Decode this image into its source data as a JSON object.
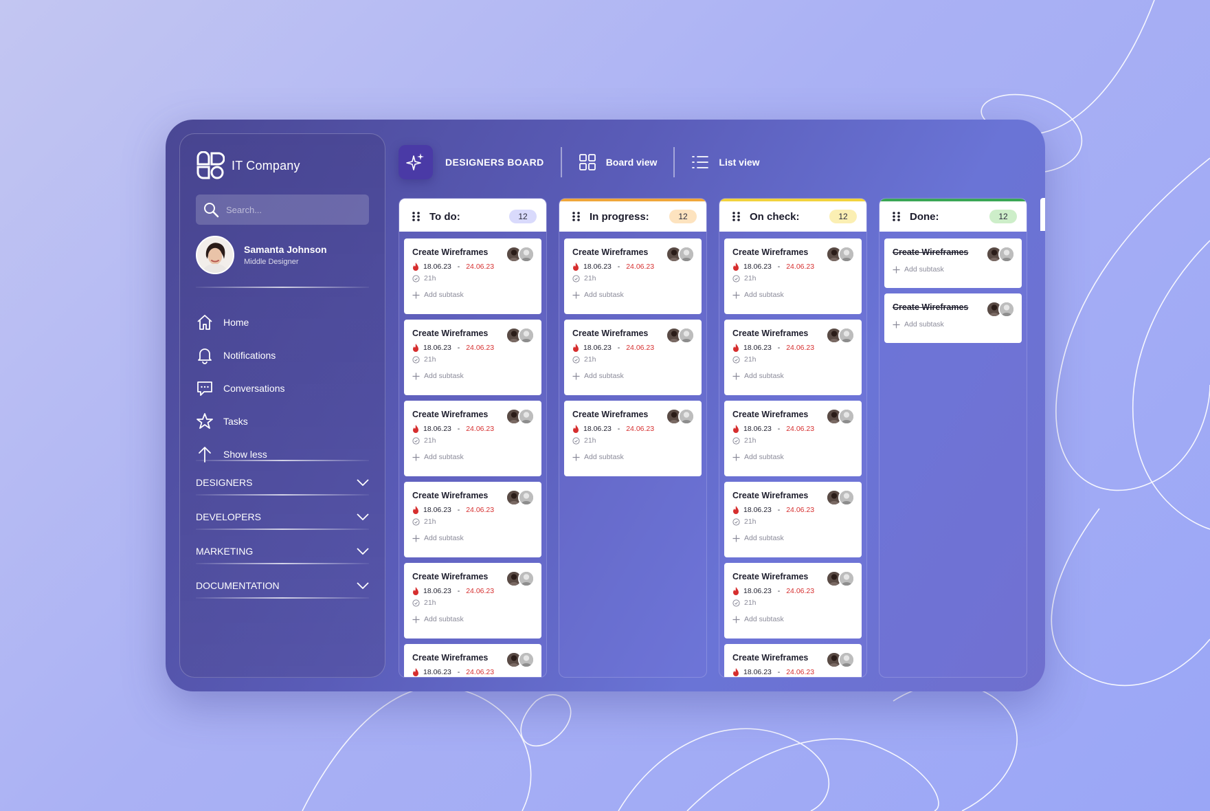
{
  "app": {
    "brand_name": "IT Company",
    "search_placeholder": "Search...",
    "user": {
      "name": "Samanta Johnson",
      "role": "Middle Designer"
    },
    "nav": [
      {
        "label": "Home",
        "icon": "home-icon"
      },
      {
        "label": "Notifications",
        "icon": "bell-icon"
      },
      {
        "label": "Conversations",
        "icon": "chat-icon"
      },
      {
        "label": "Tasks",
        "icon": "star-icon"
      },
      {
        "label": "Show less",
        "icon": "arrow-up-icon"
      }
    ],
    "groups": [
      "DESIGNERS",
      "DEVELOPERS",
      "MARKETING",
      "DOCUMENTATION"
    ]
  },
  "header": {
    "board_title": "DESIGNERS BOARD",
    "board_view_label": "Board view",
    "list_view_label": "List view"
  },
  "card_text": {
    "title": "Create Wireframes",
    "start": "18.06.23",
    "separator": " - ",
    "due": "24.06.23",
    "time": "21h",
    "add_subtask": "Add subtask"
  },
  "columns": [
    {
      "title": "To do:",
      "count": "12",
      "accent": "#ffffff",
      "badge_color": "#d9dafc",
      "cards": 6,
      "style": "full"
    },
    {
      "title": "In progress:",
      "count": "12",
      "accent": "#f0a63a",
      "badge_color": "#fde3bf",
      "cards": 3,
      "style": "full"
    },
    {
      "title": "On check:",
      "count": "12",
      "accent": "#f2d23c",
      "badge_color": "#fbefb3",
      "cards": 6,
      "style": "full"
    },
    {
      "title": "Done:",
      "count": "12",
      "accent": "#3aa655",
      "badge_color": "#cdeec9",
      "cards": 2,
      "style": "done"
    }
  ]
}
